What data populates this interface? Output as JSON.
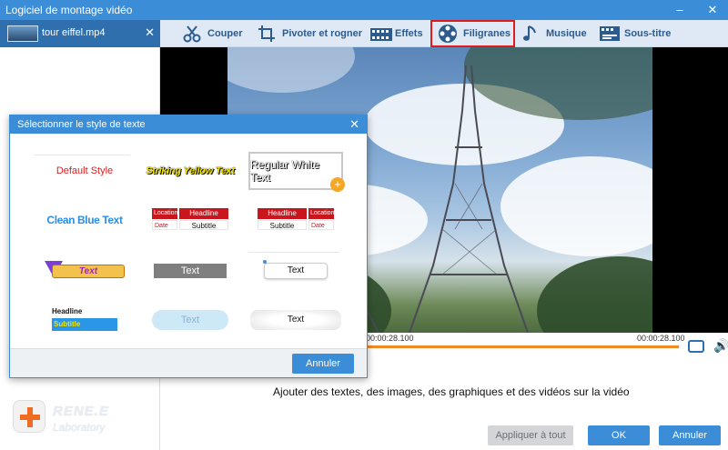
{
  "window": {
    "title": "Logiciel de montage vidéo",
    "minimize": "–",
    "close": "✕"
  },
  "sidebar": {
    "file_name": "tour eiffel.mp4",
    "close_glyph": "✕"
  },
  "toolbar": {
    "items": [
      {
        "label": "Couper",
        "icon": "scissors-icon"
      },
      {
        "label": "Pivoter et rogner",
        "icon": "crop-rotate-icon"
      },
      {
        "label": "Effets",
        "icon": "effects-film-icon"
      },
      {
        "label": "Filigranes",
        "icon": "film-reel-icon",
        "active": true
      },
      {
        "label": "Musique",
        "icon": "music-note-icon"
      },
      {
        "label": "Sous-titre",
        "icon": "subtitle-icon"
      }
    ],
    "active_border_color": "#e01b1b"
  },
  "timeline": {
    "current_time": "00:00:28.100",
    "end_time": "00:00:28.100"
  },
  "description": "Ajouter des textes, des images, des graphiques et des vidéos sur la vidéo",
  "brand": {
    "name": "RENE.E",
    "tagline": "Laboratory"
  },
  "footer": {
    "apply_all": "Appliquer à tout",
    "ok": "OK",
    "cancel": "Annuler"
  },
  "dialog": {
    "title": "Sélectionner le style de texte",
    "close_glyph": "✕",
    "cancel": "Annuler",
    "styles": {
      "default": "Default Style",
      "yellow": "Striking Yellow Text",
      "white": "Regular White Text",
      "blue": "Clean Blue Text",
      "headline1": {
        "location": "Location",
        "date": "Date",
        "headline": "Headline",
        "subtitle": "Subtitle"
      },
      "headline2": {
        "location": "Location",
        "date": "Date",
        "headline": "Headline",
        "subtitle": "Subtitle"
      },
      "banner": "Text",
      "grey": "Text",
      "pill": "Text",
      "hs": {
        "headline": "Headline",
        "subtitle": "Subtitle"
      },
      "cloud": "Text",
      "fluffy": "Text",
      "add_glyph": "+"
    }
  },
  "colors": {
    "accent": "#3c8dd8",
    "timeline_bar": "#f08a24"
  }
}
